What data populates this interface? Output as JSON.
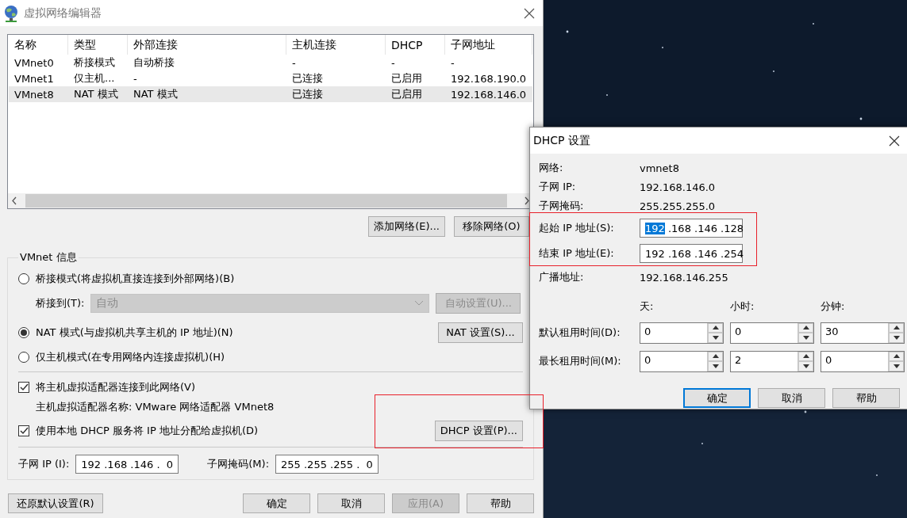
{
  "main_window": {
    "title": "虚拟网络编辑器",
    "network_table": {
      "columns": [
        "名称",
        "类型",
        "外部连接",
        "主机连接",
        "DHCP",
        "子网地址"
      ],
      "rows": [
        {
          "cells": [
            "VMnet0",
            "桥接模式",
            "自动桥接",
            "-",
            "-",
            "-"
          ],
          "selected": false
        },
        {
          "cells": [
            "VMnet1",
            "仅主机...",
            "-",
            "已连接",
            "已启用",
            "192.168.190.0"
          ],
          "selected": false
        },
        {
          "cells": [
            "VMnet8",
            "NAT 模式",
            "NAT 模式",
            "已连接",
            "已启用",
            "192.168.146.0"
          ],
          "selected": true
        }
      ]
    },
    "table_buttons": [
      {
        "label": "添加网络(E)..."
      },
      {
        "label": "移除网络(O)"
      }
    ],
    "vmnet_info": {
      "title": "VMnet 信息",
      "modes": [
        {
          "label": "桥接模式(将虚拟机直接连接到外部网络)(B)",
          "selected": false
        },
        {
          "label": "NAT 模式(与虚拟机共享主机的 IP 地址)(N)",
          "selected": true,
          "button": {
            "label": "NAT 设置(S)...",
            "disabled": false
          }
        },
        {
          "label": "仅主机模式(在专用网络内连接虚拟机)(H)",
          "selected": false
        }
      ],
      "bridge_to": {
        "label": "桥接到(T):",
        "value": "自动",
        "disabled": true,
        "button": {
          "label": "自动设置(U)...",
          "disabled": true
        }
      },
      "options": [
        {
          "label": "将主机虚拟适配器连接到此网络(V)",
          "checked": true
        },
        {
          "label": "使用本地 DHCP 服务将 IP 地址分配给虚拟机(D)",
          "checked": true,
          "button": {
            "label": "DHCP 设置(P)...",
            "disabled": false
          }
        }
      ],
      "adapter_name": "主机虚拟适配器名称: VMware 网络适配器 VMnet8",
      "subnet_ip": {
        "label": "子网 IP (I):",
        "value": "192 .168 .146 .  0"
      },
      "subnet_mask": {
        "label": "子网掩码(M):",
        "value": "255 .255 .255 .  0"
      }
    },
    "footer_buttons": [
      {
        "label": "还原默认设置(R)",
        "disabled": false
      },
      {
        "label": "确定",
        "disabled": false
      },
      {
        "label": "取消",
        "disabled": false
      },
      {
        "label": "应用(A)",
        "disabled": true
      },
      {
        "label": "帮助",
        "disabled": false
      }
    ]
  },
  "dhcp_dialog": {
    "title": "DHCP 设置",
    "info": [
      {
        "label": "网络:",
        "value": "vmnet8"
      },
      {
        "label": "子网 IP:",
        "value": "192.168.146.0"
      },
      {
        "label": "子网掩码:",
        "value": "255.255.255.0"
      }
    ],
    "ip_range": [
      {
        "label": "起始 IP 地址(S):",
        "octets": [
          {
            "text": "192",
            "selected": true
          },
          {
            "text": " .168",
            "selected": false
          },
          {
            "text": " .146",
            "selected": false
          },
          {
            "text": " .128",
            "selected": false
          }
        ]
      },
      {
        "label": "结束 IP 地址(E):",
        "octets": [
          {
            "text": "192",
            "selected": false
          },
          {
            "text": " .168",
            "selected": false
          },
          {
            "text": " .146",
            "selected": false
          },
          {
            "text": " .254",
            "selected": false
          }
        ]
      }
    ],
    "broadcast": {
      "label": "广播地址:",
      "value": "192.168.146.255"
    },
    "lease_headers": [
      "天:",
      "小时:",
      "分钟:"
    ],
    "lease_rows": [
      {
        "label": "默认租用时间(D):",
        "values": [
          "0",
          "0",
          "30"
        ]
      },
      {
        "label": "最长租用时间(M):",
        "values": [
          "0",
          "2",
          "0"
        ]
      }
    ],
    "buttons": [
      {
        "label": "确定",
        "default": true
      },
      {
        "label": "取消",
        "default": false
      },
      {
        "label": "帮助",
        "default": false
      }
    ]
  }
}
